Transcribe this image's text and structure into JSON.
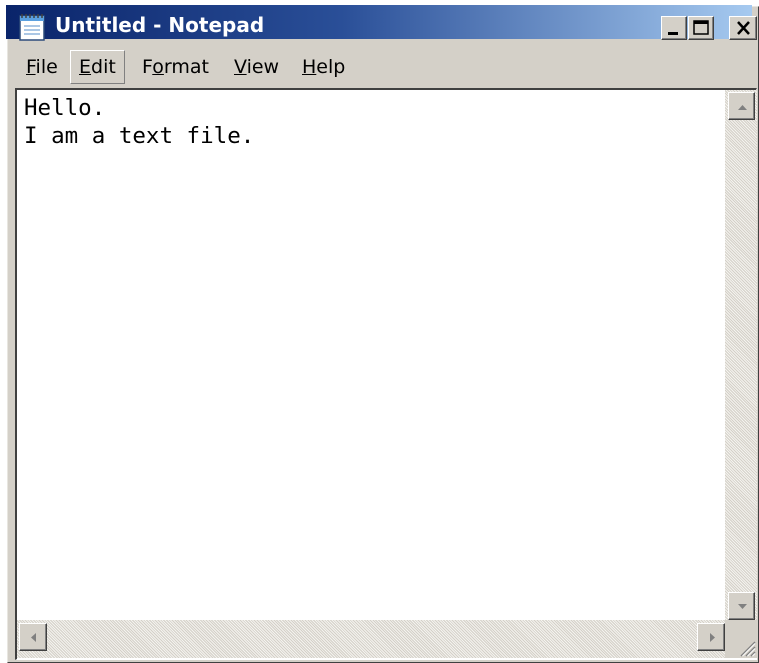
{
  "window": {
    "title": "Untitled - Notepad"
  },
  "icons": {
    "app": "notepad-icon",
    "minimize": "minimize-icon",
    "maximize": "maximize-icon",
    "close": "close-icon",
    "scroll_up": "arrow-up-icon",
    "scroll_down": "arrow-down-icon",
    "scroll_left": "arrow-left-icon",
    "scroll_right": "arrow-right-icon",
    "size_grip": "resize-grip-icon"
  },
  "menu": {
    "file": {
      "accel": "F",
      "rest": "ile"
    },
    "edit": {
      "accel": "E",
      "rest": "dit"
    },
    "format": {
      "pre": "F",
      "accel": "o",
      "rest": "rmat"
    },
    "view": {
      "accel": "V",
      "rest": "iew"
    },
    "help": {
      "accel": "H",
      "rest": "elp"
    }
  },
  "editor": {
    "content": "Hello.\nI am a text file."
  },
  "colors": {
    "titlebar_start": "#0a246a",
    "titlebar_end": "#a6caf0",
    "face": "#d4d0c8"
  }
}
